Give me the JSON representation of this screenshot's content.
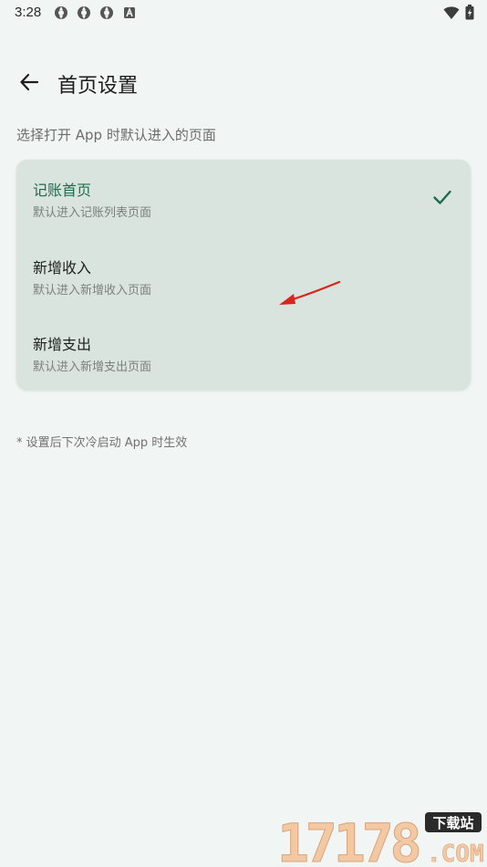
{
  "status_bar": {
    "time": "3:28",
    "notifications": [
      "sync-icon",
      "sync-icon",
      "sync-icon",
      "a-badge-icon"
    ],
    "right_icons": [
      "wifi-icon",
      "battery-icon"
    ]
  },
  "header": {
    "back_icon": "arrow-left-icon",
    "title": "首页设置"
  },
  "subtitle": "选择打开 App 时默认进入的页面",
  "options": [
    {
      "title": "记账首页",
      "desc": "默认进入记账列表页面",
      "selected": true
    },
    {
      "title": "新增收入",
      "desc": "默认进入新增收入页面",
      "selected": false
    },
    {
      "title": "新增支出",
      "desc": "默认进入新增支出页面",
      "selected": false
    }
  ],
  "footnote": "* 设置后下次冷启动 App 时生效",
  "watermark": {
    "brand": "17178",
    "tag": "下载站",
    "domain": ".COM"
  },
  "colors": {
    "background": "#f1f5f3",
    "card": "#d9e4de",
    "accent": "#1f6b4c",
    "annotation_arrow": "#d8261d"
  }
}
